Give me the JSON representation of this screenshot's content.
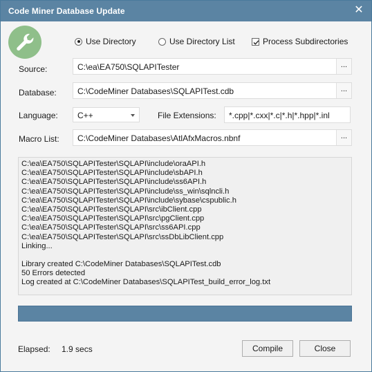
{
  "window": {
    "title": "Code Miner Database Update",
    "close_glyph": "✕"
  },
  "colors": {
    "accent": "#5b84a3",
    "logo": "#8fbf8a"
  },
  "options": {
    "use_directory": {
      "label": "Use Directory",
      "selected": true
    },
    "use_directory_list": {
      "label": "Use Directory List",
      "selected": false
    },
    "process_subdirectories": {
      "label": "Process Subdirectories",
      "checked": true
    }
  },
  "form": {
    "source": {
      "label": "Source:",
      "value": "C:\\ea\\EA750\\SQLAPITester",
      "browse": "..."
    },
    "database": {
      "label": "Database:",
      "value": "C:\\CodeMiner Databases\\SQLAPITest.cdb",
      "browse": "..."
    },
    "language": {
      "label": "Language:",
      "value": "C++"
    },
    "file_extensions": {
      "label": "File Extensions:",
      "value": "*.cpp|*.cxx|*.c|*.h|*.hpp|*.inl"
    },
    "macro_list": {
      "label": "Macro List:",
      "value": "C:\\CodeMiner Databases\\AtlAfxMacros.nbnf",
      "browse": "..."
    }
  },
  "log": {
    "lines": [
      "C:\\ea\\EA750\\SQLAPITester\\SQLAPI\\include\\oraAPI.h",
      "C:\\ea\\EA750\\SQLAPITester\\SQLAPI\\include\\sbAPI.h",
      "C:\\ea\\EA750\\SQLAPITester\\SQLAPI\\include\\ss6API.h",
      "C:\\ea\\EA750\\SQLAPITester\\SQLAPI\\include\\ss_win\\sqlncli.h",
      "C:\\ea\\EA750\\SQLAPITester\\SQLAPI\\include\\sybase\\cspublic.h",
      "C:\\ea\\EA750\\SQLAPITester\\SQLAPI\\src\\ibClient.cpp",
      "C:\\ea\\EA750\\SQLAPITester\\SQLAPI\\src\\pgClient.cpp",
      "C:\\ea\\EA750\\SQLAPITester\\SQLAPI\\src\\ss6API.cpp",
      "C:\\ea\\EA750\\SQLAPITester\\SQLAPI\\src\\ssDbLibClient.cpp",
      "Linking...",
      "",
      "Library created C:\\CodeMiner Databases\\SQLAPITest.cdb",
      "50 Errors detected",
      "Log created at C:\\CodeMiner Databases\\SQLAPITest_build_error_log.txt"
    ]
  },
  "progress": {
    "percent": 100
  },
  "footer": {
    "elapsed_label": "Elapsed:",
    "elapsed_value": "1.9 secs",
    "compile_label": "Compile",
    "close_label": "Close"
  }
}
